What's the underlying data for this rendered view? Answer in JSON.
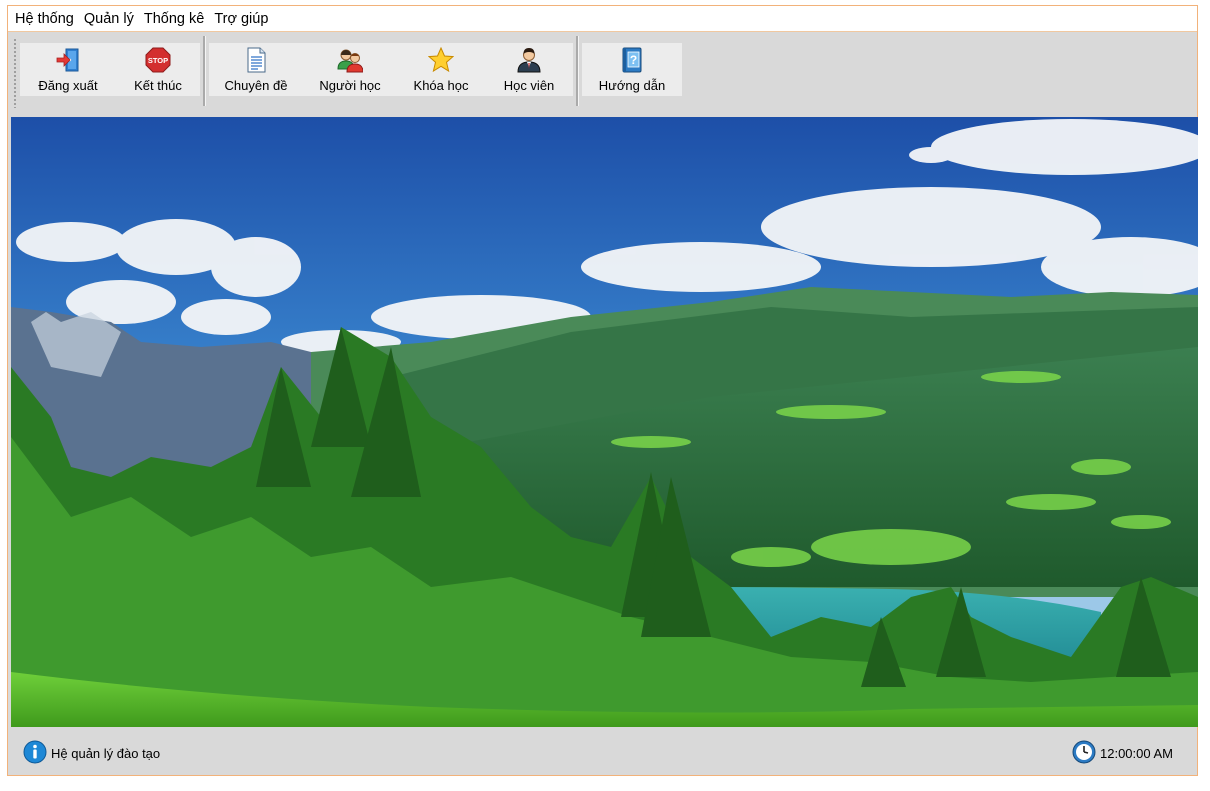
{
  "menu": {
    "items": [
      "Hệ thống",
      "Quản lý",
      "Thống kê",
      "Trợ giúp"
    ]
  },
  "toolbar": {
    "logout_label": "Đăng xuất",
    "exit_label": "Kết thúc",
    "topics_label": "Chuyên đề",
    "learners_label": "Người học",
    "courses_label": "Khóa học",
    "students_label": "Học viên",
    "guide_label": "Hướng dẫn",
    "stop_icon_text": "STOP"
  },
  "status": {
    "app_name": "Hệ quản lý đào tạo",
    "clock": "12:00:00 AM"
  },
  "icons": {
    "logout": "logout-door-icon",
    "exit": "stop-sign-icon",
    "topics": "document-icon",
    "learners": "users-icon",
    "courses": "star-icon",
    "students": "student-icon",
    "guide": "help-book-icon",
    "info": "info-icon",
    "clock": "clock-icon"
  },
  "colors": {
    "window_border": "#f2b27a",
    "toolbar_bg": "#ececec",
    "chrome_bg": "#d9d9d9",
    "info_blue": "#1e88d6"
  }
}
